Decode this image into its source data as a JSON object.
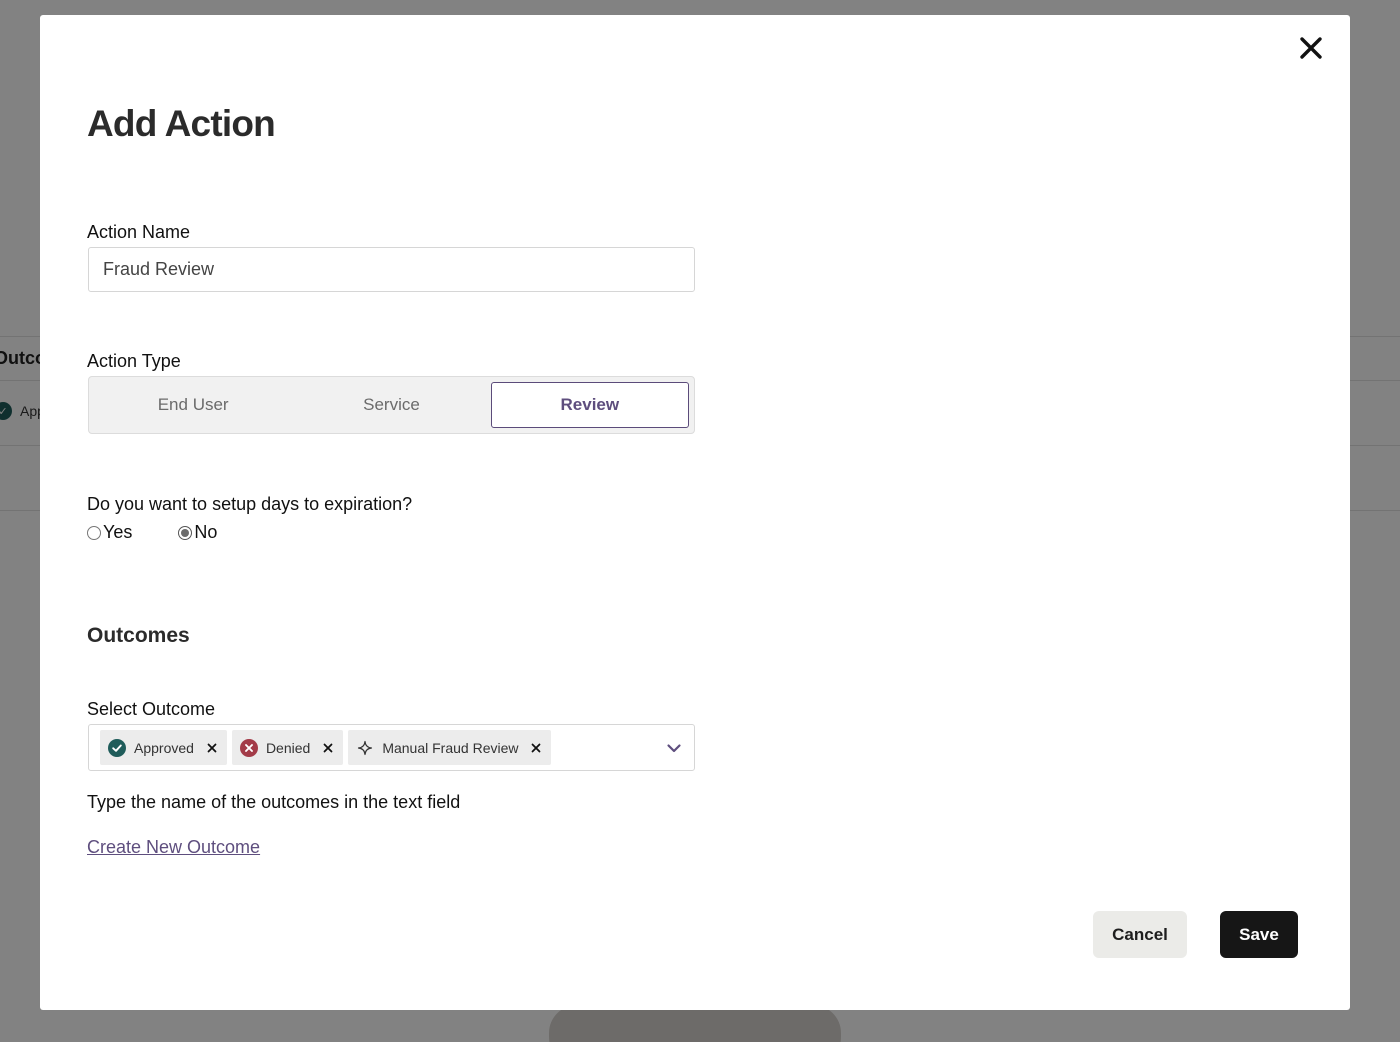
{
  "background": {
    "heading": "Outcomes",
    "chip_label": "Approved"
  },
  "modal": {
    "title": "Add Action",
    "close_icon": "close-icon",
    "action_name": {
      "label": "Action Name",
      "value": "Fraud Review",
      "placeholder": ""
    },
    "action_type": {
      "label": "Action Type",
      "options": [
        "End User",
        "Service",
        "Review"
      ],
      "selected": "Review"
    },
    "expiration": {
      "question": "Do you want to setup days to expiration?",
      "options": [
        "Yes",
        "No"
      ],
      "selected": "No"
    },
    "outcomes": {
      "heading": "Outcomes",
      "select_label": "Select Outcome",
      "selected_chips": [
        {
          "label": "Approved",
          "icon": "check-circle-icon",
          "color": "#1f5c5a"
        },
        {
          "label": "Denied",
          "icon": "x-circle-icon",
          "color": "#a33b48"
        },
        {
          "label": "Manual Fraud Review",
          "icon": "sparkle-icon",
          "color": "#333333"
        }
      ],
      "help_text": "Type the name of the outcomes in the text field",
      "create_link": "Create New Outcome"
    },
    "buttons": {
      "cancel": "Cancel",
      "save": "Save"
    }
  },
  "colors": {
    "accent": "#5e4e7e",
    "primary_button": "#161616",
    "secondary_button": "#ebebe8"
  }
}
